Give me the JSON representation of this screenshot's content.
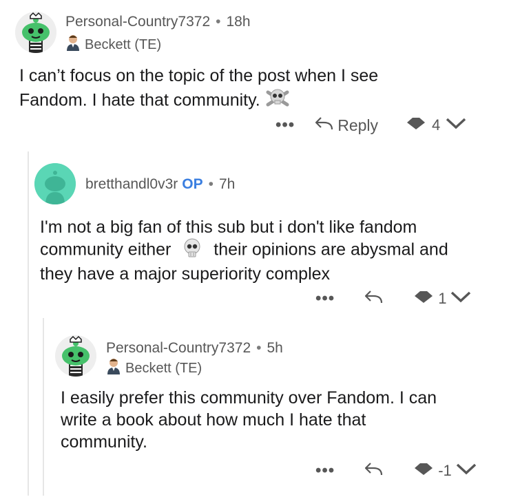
{
  "comments": [
    {
      "username": "Personal-Country7372",
      "separator": "•",
      "time": "18h",
      "flair": "Beckett (TE)",
      "lines": [
        "I can’t focus on the topic of the post when I see",
        "Fandom. I hate that community."
      ],
      "more_label": "•••",
      "reply_label": "Reply",
      "vote_count": "4"
    },
    {
      "username": "bretthandl0v3r",
      "op_badge": "OP",
      "separator": "•",
      "time": "7h",
      "lines": [
        "I'm not a big fan of this sub but i don't like fandom",
        "community either",
        "their opinions are abysmal and",
        "they have a major superiority complex"
      ],
      "more_label": "•••",
      "vote_count": "1"
    },
    {
      "username": "Personal-Country7372",
      "separator": "•",
      "time": "5h",
      "flair": "Beckett (TE)",
      "lines": [
        "I easily prefer this community over Fandom. I can",
        "write a book about how much I hate that",
        "community."
      ],
      "more_label": "•••",
      "vote_count": "-1"
    }
  ],
  "icons": [
    "snoo-avatar-icon",
    "beckett-flair-icon",
    "skull-crossbones-icon",
    "skull-icon",
    "reply-arrow-icon",
    "upvote-icon",
    "downvote-icon"
  ],
  "colors": {
    "op": "#3b7fe0",
    "snoo_green": "#46c16b",
    "teal_avatar": "#5ad6b5",
    "meta": "#575757"
  }
}
